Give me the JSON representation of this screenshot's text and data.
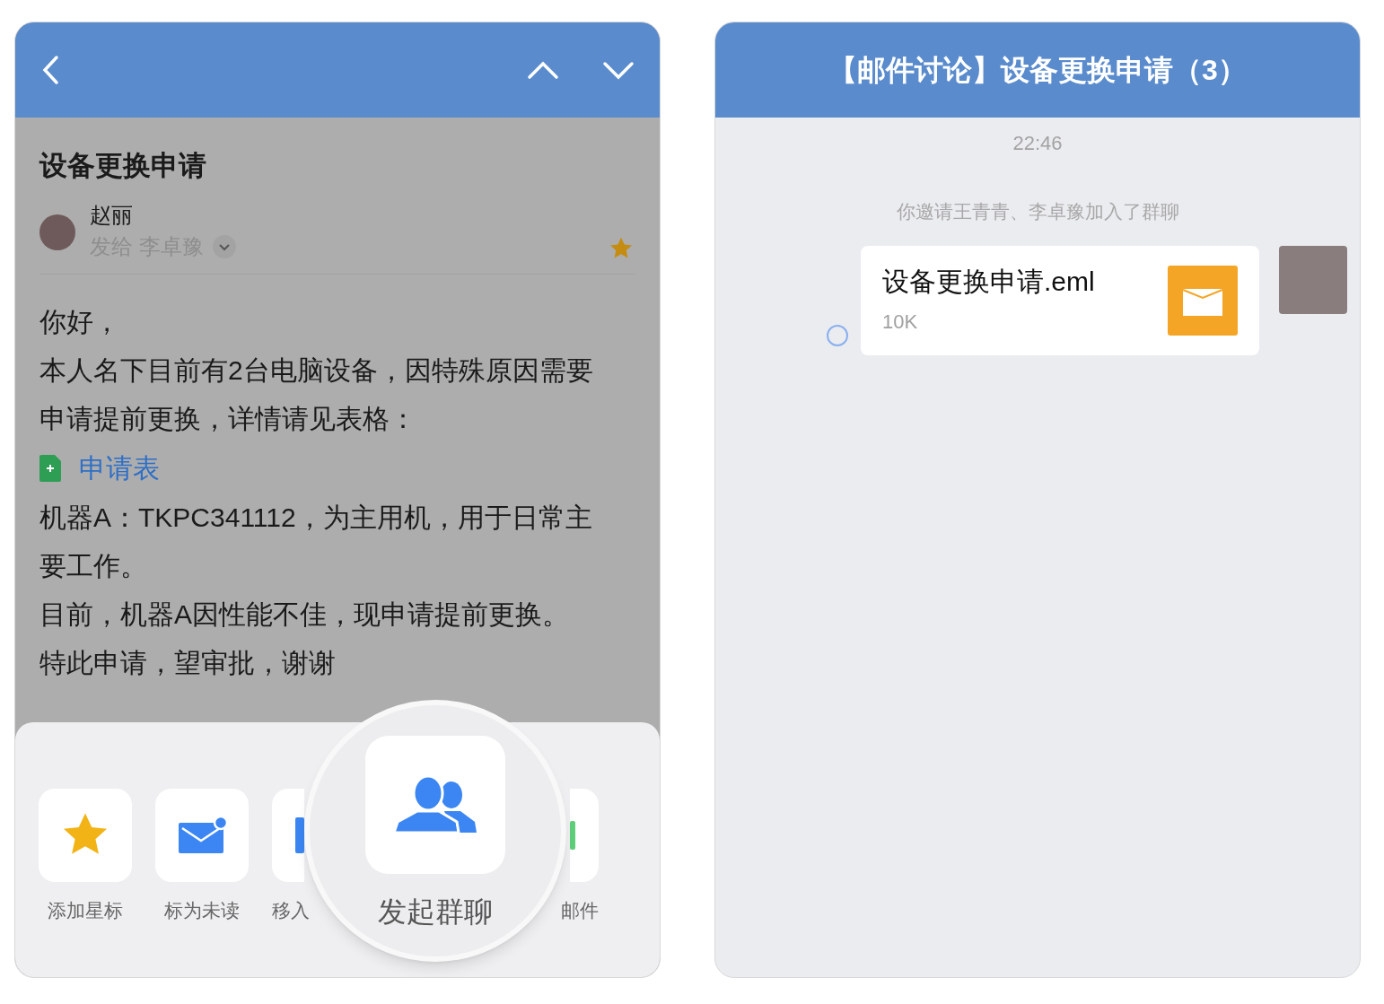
{
  "email_screen": {
    "subject": "设备更换申请",
    "sender": "赵丽",
    "recipient_line": "发给 李卓豫",
    "starred": true,
    "body": [
      {
        "kind": "text",
        "text": "你好，"
      },
      {
        "kind": "text",
        "text": "本人名下目前有2台电脑设备，因特殊原因需要申请提前更换，详情请见表格："
      },
      {
        "kind": "attachment",
        "text": "申请表"
      },
      {
        "kind": "text",
        "text": "机器A：TKPC341112，为主用机，用于日常主要工作。"
      },
      {
        "kind": "text",
        "text": "目前，机器A因性能不佳，现申请提前更换。"
      },
      {
        "kind": "text",
        "text": "特此申请，望审批，谢谢"
      }
    ],
    "actions": [
      {
        "kind": "star",
        "label": "添加星标"
      },
      {
        "kind": "unread",
        "label": "标为未读"
      },
      {
        "kind": "folder",
        "label": "移入"
      },
      {
        "kind": "green",
        "label": "邮件"
      }
    ],
    "magnified_action": {
      "label": "发起群聊"
    }
  },
  "chat_screen": {
    "title": "【邮件讨论】设备更换申请（3）",
    "time": "22:46",
    "system_message": "你邀请王青青、李卓豫加入了群聊",
    "message": {
      "file_name": "设备更换申请.eml",
      "file_size": "10K",
      "unread": true
    }
  }
}
